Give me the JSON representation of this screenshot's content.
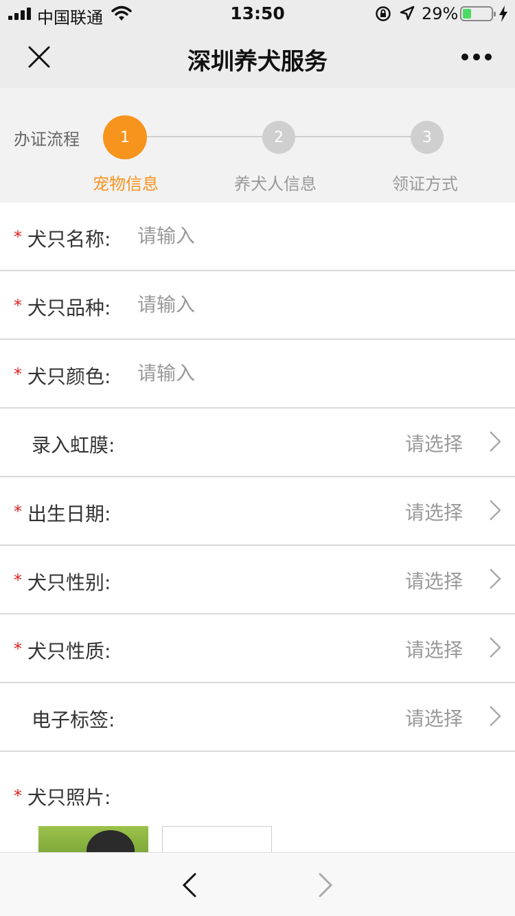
{
  "status_bar": {
    "carrier": "中国联通",
    "time": "13:50",
    "battery_pct": "29%",
    "battery_level": 0.29,
    "icons": [
      "signal-icon",
      "wifi-icon",
      "rotation-lock-icon",
      "location-icon",
      "battery-icon",
      "charging-icon"
    ]
  },
  "nav": {
    "title": "深圳养犬服务",
    "close_icon": "close-icon",
    "more_icon": "more-icon"
  },
  "steps": {
    "title": "办证流程",
    "items": [
      {
        "number": "1",
        "label": "宠物信息",
        "active": true
      },
      {
        "number": "2",
        "label": "养犬人信息",
        "active": false
      },
      {
        "number": "3",
        "label": "领证方式",
        "active": false
      }
    ],
    "active_color": "#f7941d",
    "inactive_color": "#cfcfcf"
  },
  "form": {
    "fields": [
      {
        "label": "犬只名称:",
        "required": true,
        "type": "input",
        "placeholder": "请输入"
      },
      {
        "label": "犬只品种:",
        "required": true,
        "type": "input",
        "placeholder": "请输入"
      },
      {
        "label": "犬只颜色:",
        "required": true,
        "type": "input",
        "placeholder": "请输入"
      },
      {
        "label": "录入虹膜:",
        "required": false,
        "type": "select",
        "placeholder": "请选择"
      },
      {
        "label": "出生日期:",
        "required": true,
        "type": "select",
        "placeholder": "请选择"
      },
      {
        "label": "犬只性别:",
        "required": true,
        "type": "select",
        "placeholder": "请选择"
      },
      {
        "label": "犬只性质:",
        "required": true,
        "type": "select",
        "placeholder": "请选择"
      },
      {
        "label": "电子标签:",
        "required": false,
        "type": "select",
        "placeholder": "请选择"
      }
    ],
    "photo_label": "犬只照片:",
    "required_mark": "*"
  },
  "toolbar": {
    "back_icon": "chevron-left-icon",
    "forward_icon": "chevron-right-icon"
  }
}
